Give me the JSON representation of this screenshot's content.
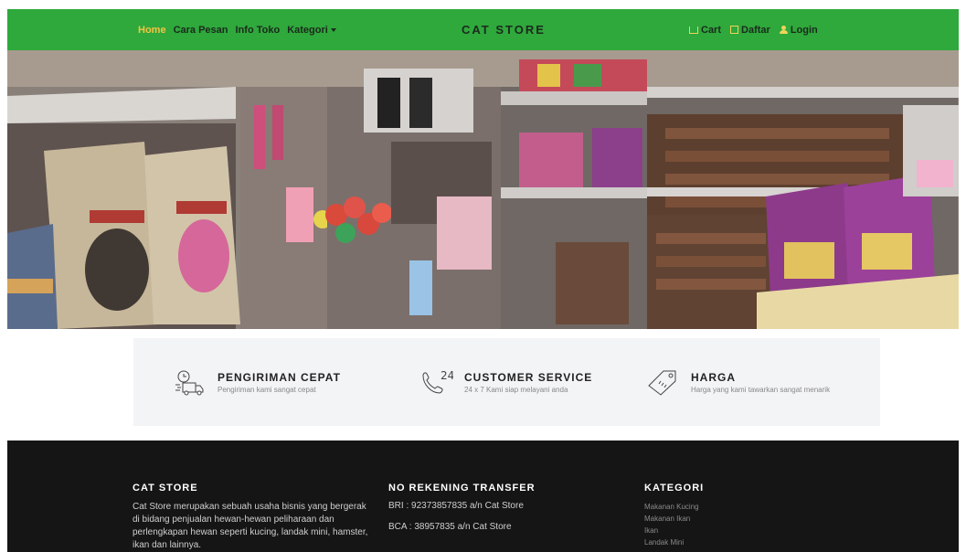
{
  "nav": {
    "links": [
      "Home",
      "Cara Pesan",
      "Info Toko",
      "Kategori"
    ],
    "brand": "CAT STORE",
    "cart": "Cart",
    "daftar": "Daftar",
    "login": "Login"
  },
  "colors": {
    "navbar": "#2fa83c",
    "active_link": "#f4c542",
    "footer": "#151515",
    "feature_bg": "#f3f4f6"
  },
  "features": [
    {
      "icon": "delivery-truck-icon",
      "title": "PENGIRIMAN CEPAT",
      "desc": "Pengiriman kami sangat cepat"
    },
    {
      "icon": "phone-24-icon",
      "title": "CUSTOMER SERVICE",
      "desc": "24 x 7 Kami siap melayani anda",
      "icon_text": "24"
    },
    {
      "icon": "price-tag-icon",
      "title": "HARGA",
      "desc": "Harga yang kami tawarkan sangat menarik"
    }
  ],
  "footer": {
    "about_title": "CAT STORE",
    "about_text": "Cat Store merupakan sebuah usaha bisnis yang bergerak di bidang penjualan hewan-hewan peliharaan dan perlengkapan hewan seperti kucing, landak mini, hamster, ikan dan lainnya.",
    "bank_title": "NO REKENING TRANSFER",
    "bank_bri": "BRI : 92373857835 a/n Cat Store",
    "bank_bca": "BCA : 38957835 a/n Cat Store",
    "kategori_title": "KATEGORI",
    "kategori": [
      "Makanan Kucing",
      "Makanan Ikan",
      "Ikan",
      "Landak Mini"
    ]
  }
}
